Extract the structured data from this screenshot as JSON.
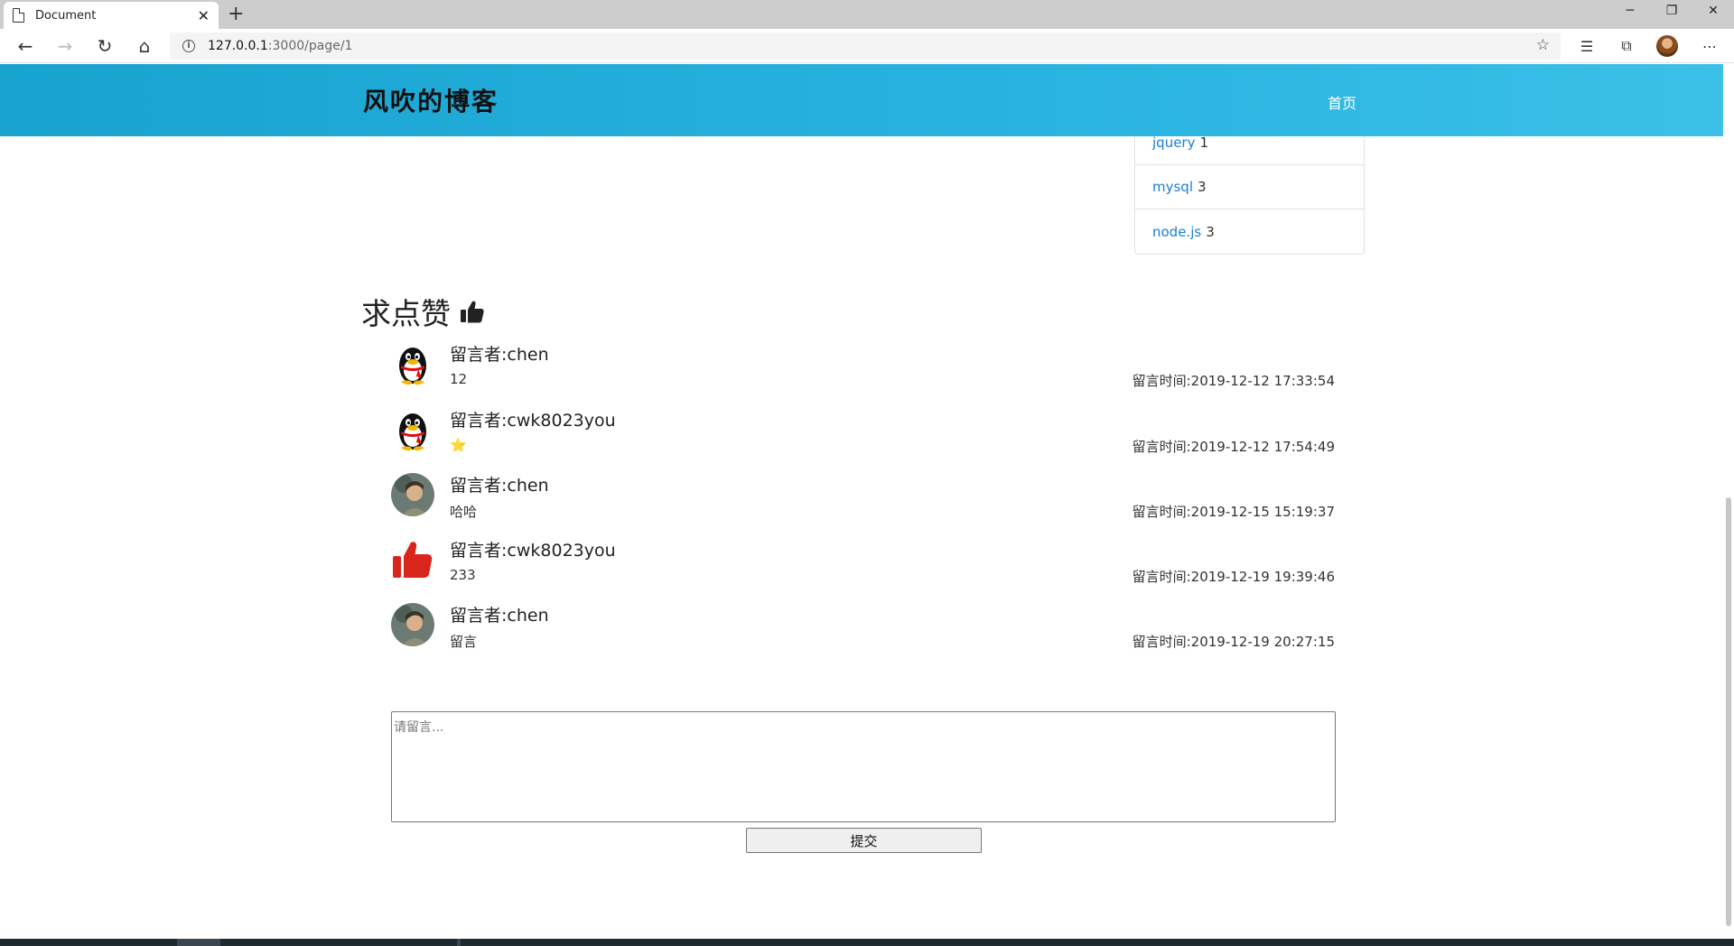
{
  "browser": {
    "tab_title": "Document",
    "tab_close": "✕",
    "new_tab": "+",
    "url_host": "127.0.0.1",
    "url_path": ":3000/page/1"
  },
  "navbar": {
    "brand": "风吹的博客",
    "home": "首页"
  },
  "tags": [
    {
      "name": "jquery",
      "count": "1"
    },
    {
      "name": "mysql",
      "count": "3"
    },
    {
      "name": "node.js",
      "count": "3"
    }
  ],
  "like_section": {
    "title": "求点赞"
  },
  "comments": [
    {
      "author": "留言者:chen",
      "content": "12",
      "time": "留言时间:2019-12-12 17:33:54",
      "avatar": "qq-penguin"
    },
    {
      "author": "留言者:cwk8023you",
      "content": "⭐",
      "time": "留言时间:2019-12-12 17:54:49",
      "avatar": "qq-penguin"
    },
    {
      "author": "留言者:chen",
      "content": "哈哈",
      "time": "留言时间:2019-12-15 15:19:37",
      "avatar": "photo"
    },
    {
      "author": "留言者:cwk8023you",
      "content": "233",
      "time": "留言时间:2019-12-19 19:39:46",
      "avatar": "thumbs-up"
    },
    {
      "author": "留言者:chen",
      "content": "留言",
      "time": "留言时间:2019-12-19 20:27:15",
      "avatar": "photo"
    }
  ],
  "form": {
    "placeholder": "请留言...",
    "submit": "提交"
  },
  "colors": {
    "navbar_start": "#18a3cf",
    "navbar_end": "#3bc0e8",
    "link": "#1a7fd4",
    "thumbs_red": "#d9261c"
  }
}
